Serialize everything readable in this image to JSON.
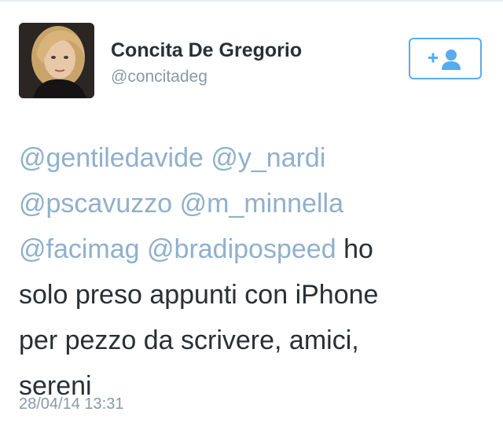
{
  "user": {
    "display_name": "Concita De Gregorio",
    "username": "@concitadeg"
  },
  "follow_button": {
    "icon": "follow-person-plus-icon",
    "accent": "#55acee"
  },
  "tweet": {
    "mentions": [
      "@gentiledavide",
      "@y_nardi",
      "@pscavuzzo",
      "@m_minnella",
      "@facimag",
      "@bradipospeed"
    ],
    "text_parts": [
      "ho",
      "solo preso appunti con iPhone",
      "per pezzo da scrivere, amici,",
      "sereni"
    ],
    "timestamp": "28/04/14 13:31"
  },
  "colors": {
    "mention": "#8fb0cc",
    "text": "#292f33",
    "muted": "#8899a6"
  }
}
